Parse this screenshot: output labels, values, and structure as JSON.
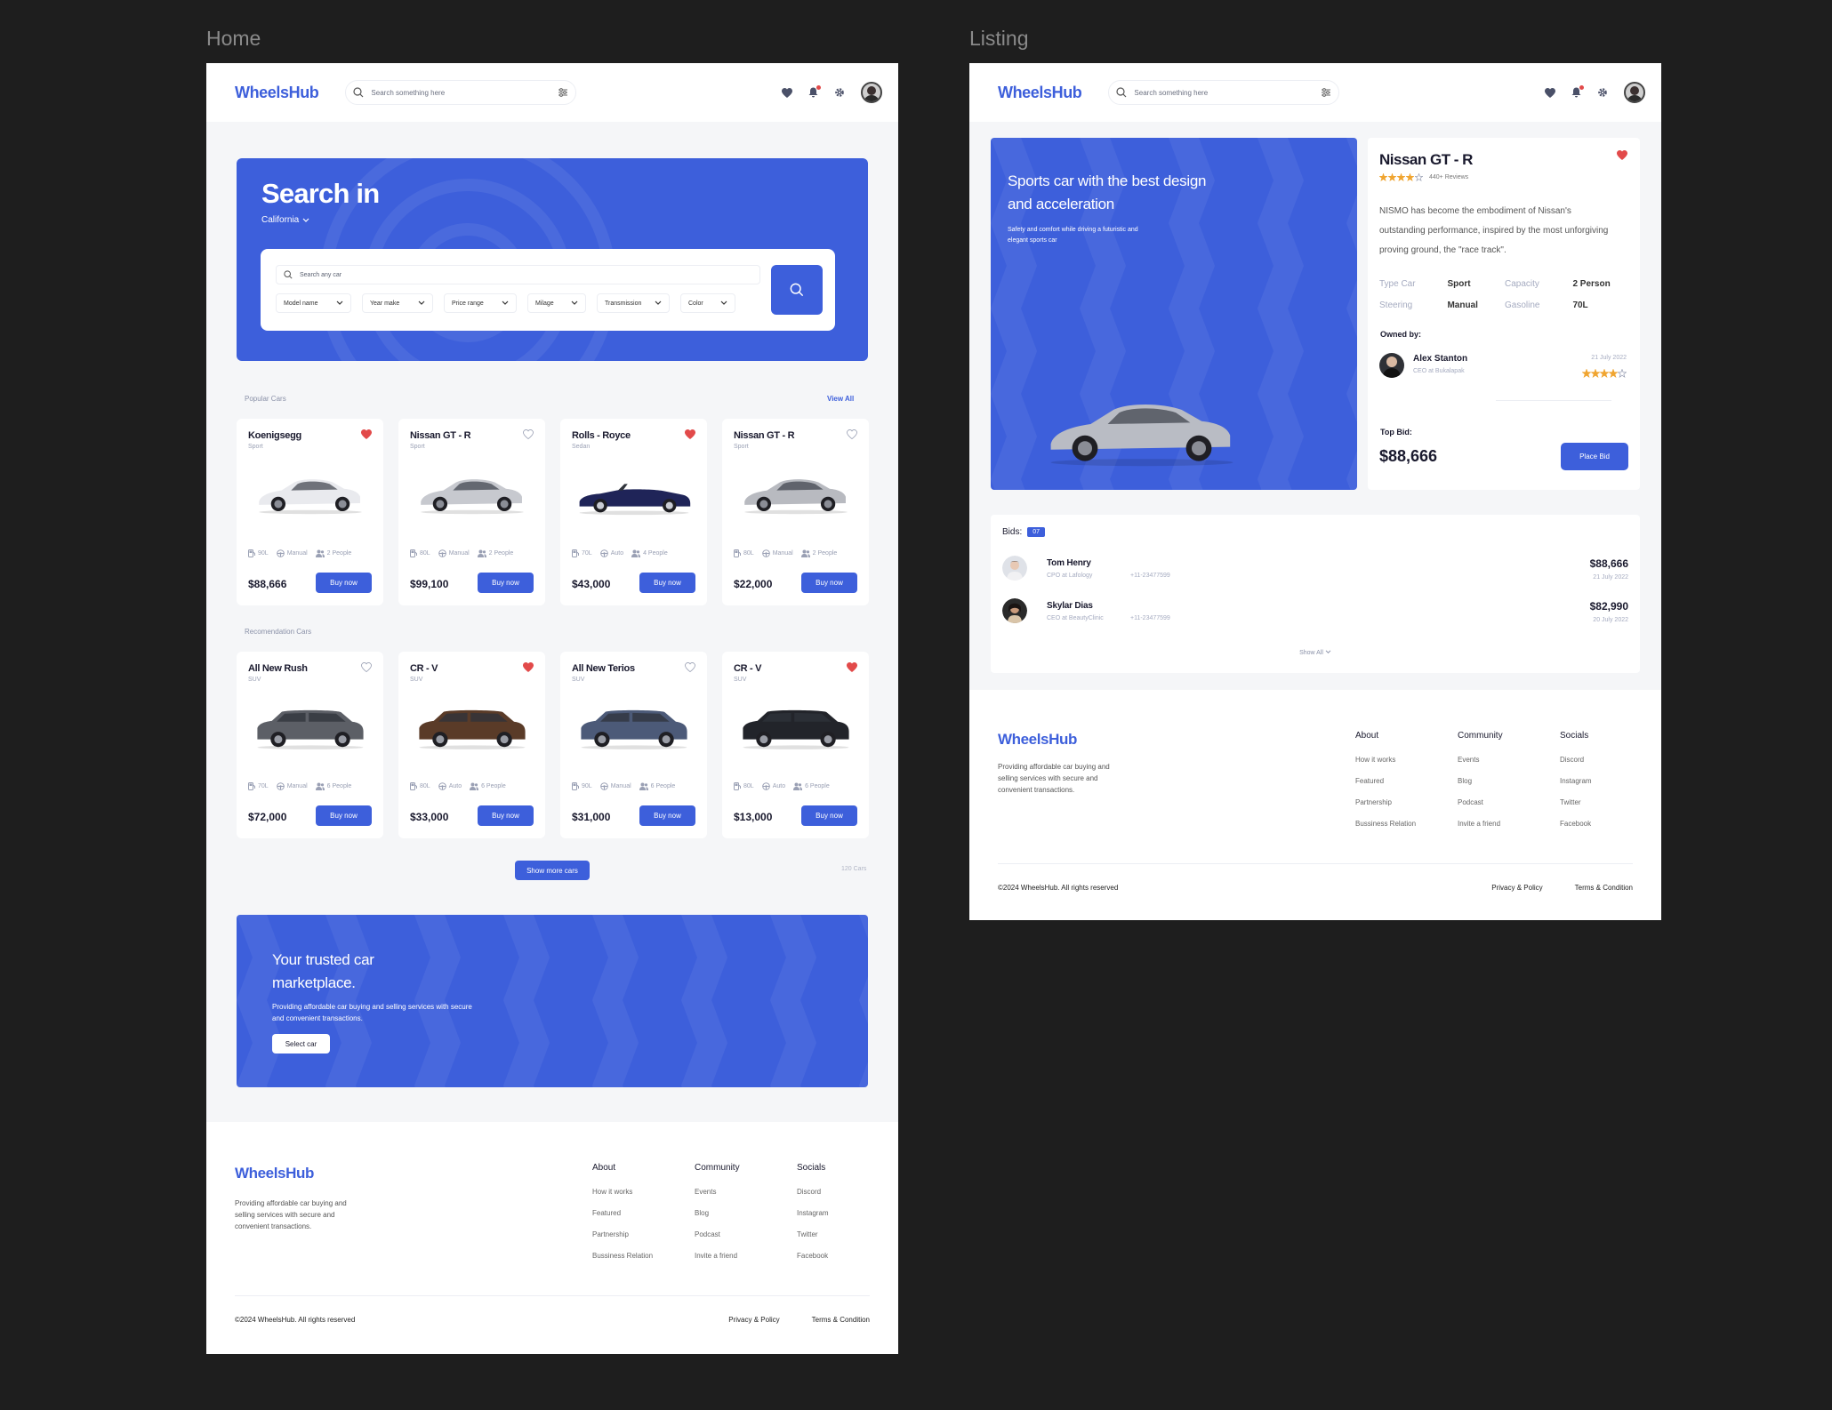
{
  "frames": {
    "home_label": "Home",
    "listing_label": "Listing"
  },
  "topbar": {
    "logo": "WheelsHub",
    "search_placeholder": "Search something here"
  },
  "colors": {
    "primary": "#3d5fdb",
    "heart_active": "#e24a4a",
    "star": "#f0a531",
    "background": "#f5f6f8"
  },
  "hero": {
    "title": "Search in",
    "location": "California",
    "search_placeholder": "Search any car",
    "filters": [
      "Model name",
      "Year make",
      "Price range",
      "Milage",
      "Transmission",
      "Color"
    ]
  },
  "popular": {
    "title": "Popular Cars",
    "view_all": "View All",
    "cars": [
      {
        "name": "Koenigsegg",
        "type": "Sport",
        "fuel": "90L",
        "trans": "Manual",
        "people": "2 People",
        "price": "$88,666",
        "buy": "Buy now",
        "favorite": true
      },
      {
        "name": "Nissan GT - R",
        "type": "Sport",
        "fuel": "80L",
        "trans": "Manual",
        "people": "2 People",
        "price": "$99,100",
        "buy": "Buy now",
        "favorite": false
      },
      {
        "name": "Rolls - Royce",
        "type": "Sedan",
        "fuel": "70L",
        "trans": "Auto",
        "people": "4 People",
        "price": "$43,000",
        "buy": "Buy now",
        "favorite": true
      },
      {
        "name": "Nissan GT - R",
        "type": "Sport",
        "fuel": "80L",
        "trans": "Manual",
        "people": "2 People",
        "price": "$22,000",
        "buy": "Buy now",
        "favorite": false
      }
    ]
  },
  "recommended": {
    "title": "Recomendation Cars",
    "cars": [
      {
        "name": "All New Rush",
        "type": "SUV",
        "fuel": "70L",
        "trans": "Manual",
        "people": "6 People",
        "price": "$72,000",
        "buy": "Buy now",
        "favorite": false
      },
      {
        "name": "CR - V",
        "type": "SUV",
        "fuel": "80L",
        "trans": "Auto",
        "people": "6 People",
        "price": "$33,000",
        "buy": "Buy now",
        "favorite": true
      },
      {
        "name": "All New Terios",
        "type": "SUV",
        "fuel": "90L",
        "trans": "Manual",
        "people": "6 People",
        "price": "$31,000",
        "buy": "Buy now",
        "favorite": false
      },
      {
        "name": "CR - V",
        "type": "SUV",
        "fuel": "80L",
        "trans": "Auto",
        "people": "6 People",
        "price": "$13,000",
        "buy": "Buy now",
        "favorite": true
      }
    ],
    "show_more": "Show more cars",
    "count": "120 Cars"
  },
  "banner": {
    "title_line1": "Your trusted car",
    "title_line2": "marketplace.",
    "desc": "Providing affordable car buying and selling services with secure and convenient transactions.",
    "button": "Select car"
  },
  "footer": {
    "logo": "WheelsHub",
    "desc": "Providing affordable car buying and selling services with secure and convenient transactions.",
    "columns": [
      {
        "title": "About",
        "links": [
          "How it works",
          "Featured",
          "Partnership",
          "Bussiness Relation"
        ]
      },
      {
        "title": "Community",
        "links": [
          "Events",
          "Blog",
          "Podcast",
          "Invite a friend"
        ]
      },
      {
        "title": "Socials",
        "links": [
          "Discord",
          "Instagram",
          "Twitter",
          "Facebook"
        ]
      }
    ],
    "copyright": "©2024 WheelsHub. All rights reserved",
    "privacy": "Privacy & Policy",
    "terms": "Terms & Condition"
  },
  "listing": {
    "hero_title": "Sports car with the best design and acceleration",
    "hero_desc": "Safety and comfort while driving a futuristic and elegant sports car",
    "car_name": "Nissan GT - R",
    "rating": 4,
    "reviews": "440+ Reviews",
    "description": "NISMO has become the embodiment of Nissan's outstanding performance, inspired by the most unforgiving proving ground, the \"race track\".",
    "specs": [
      {
        "k1": "Type Car",
        "v1": "Sport",
        "k2": "Capacity",
        "v2": "2 Person"
      },
      {
        "k1": "Steering",
        "v1": "Manual",
        "k2": "Gasoline",
        "v2": "70L"
      }
    ],
    "owned_by": "Owned by:",
    "owner": {
      "name": "Alex Stanton",
      "role": "CEO at Bukalapak",
      "date": "21 July 2022",
      "rating": 4
    },
    "top_bid_label": "Top Bid:",
    "top_bid": "$88,666",
    "place_bid": "Place Bid",
    "bids_label": "Bids:",
    "bids_count": "07",
    "bids": [
      {
        "name": "Tom Henry",
        "role": "CPO at Lafology",
        "phone": "+11-23477599",
        "amount": "$88,666",
        "date": "21 July 2022"
      },
      {
        "name": "Skylar Dias",
        "role": "CEO at BeautyClinic",
        "phone": "+11-23477599",
        "amount": "$82,990",
        "date": "20 July 2022"
      }
    ],
    "show_all": "Show All"
  }
}
